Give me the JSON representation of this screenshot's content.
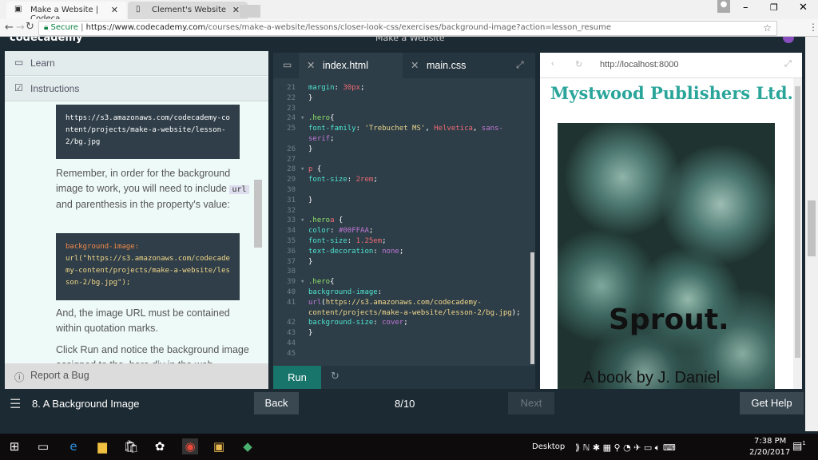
{
  "browser": {
    "tabs": [
      {
        "title": "Make a Website | Codeca"
      },
      {
        "title": "Clement's Website"
      }
    ],
    "secure_label": "Secure",
    "url_host": "https://www.codecademy.com",
    "url_path": "/courses/make-a-website/lessons/closer-look-css/exercises/background-image?action=lesson_resume"
  },
  "header": {
    "logo": "codecademy",
    "course_title": "Make a Website"
  },
  "left": {
    "learn": "Learn",
    "instructions": "Instructions",
    "code1": "https://s3.amazonaws.com/codecademy-content/projects/make-a-website/lesson-2/bg.jpg",
    "para1_a": "Remember, in order for the background image to work, you will need to include ",
    "para1_code": "url",
    "para1_b": " and parenthesis in the property's value:",
    "code2_a": "background-image:",
    "code2_b": "url(\"https://s3.amazonaws.com/codecademy-content/projects/make-a-website/lesson-2/bg.jpg\");",
    "para2": "And, the image URL must be contained within quotation marks.",
    "para3": "Click Run and notice the background image assigned to the .hero div in the web",
    "report": "Report a Bug"
  },
  "editor": {
    "tabs": [
      "index.html",
      "main.css"
    ],
    "run": "Run"
  },
  "preview": {
    "url": "http://localhost:8000",
    "title": "Mystwood Publishers Ltd.",
    "hero_title": "Sprout.",
    "hero_byline": "A book by J. Daniel"
  },
  "bottom": {
    "lesson": "8. A Background Image",
    "back": "Back",
    "progress": "8/10",
    "next": "Next",
    "help": "Get Help"
  },
  "taskbar": {
    "desktop": "Desktop",
    "time": "7:38 PM",
    "date": "2/20/2017",
    "notifications": "1"
  }
}
